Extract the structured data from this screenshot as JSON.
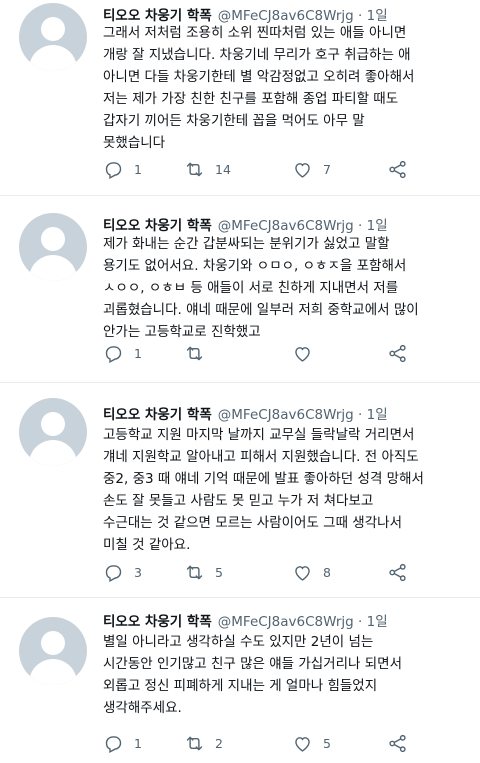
{
  "tweets": [
    {
      "name": "티오오 차웅기 학폭",
      "handle": "@MFeCJ8av6C8Wrjg",
      "time": "· 1일",
      "lines": [
        "그래서 저처럼 조용히 소위 찐따처럼 있는 애들 아니면",
        "개랑 잘 지냈습니다. 차웅기네 무리가 호구 취급하는 애",
        "아니면 다들 차웅기한테 별 악감정없고 오히려 좋아해서",
        "저는 제가 가장 친한 친구를 포함해 종업 파티할 때도",
        "갑자기 끼어든 차웅기한테 꼽을 먹어도 아무 말",
        "못했습니다"
      ],
      "replies": "1",
      "retweets": "14",
      "likes": "7"
    },
    {
      "name": "티오오 차웅기 학폭",
      "handle": "@MFeCJ8av6C8Wrjg",
      "time": "· 1일",
      "lines": [
        "제가 화내는 순간 갑분싸되는 분위기가 싫었고 말할",
        "용기도 없어서요. 차웅기와 ㅇㅁㅇ, ㅇㅎㅈ을 포함해서",
        "ㅅㅇㅇ, ㅇㅎㅂ 등 애들이 서로 친하게 지내면서 저를",
        "괴롭혔습니다. 얘네 때문에 일부러 저희 중학교에서 많이",
        "안가는 고등학교로 진학했고"
      ],
      "replies": "1",
      "retweets": "",
      "likes": ""
    },
    {
      "name": "티오오 차웅기 학폭",
      "handle": "@MFeCJ8av6C8Wrjg",
      "time": "· 1일",
      "lines": [
        "고등학교 지원 마지막 날까지 교무실 들락날락 거리면서",
        "걔네 지원학교 알아내고 피해서 지원했습니다. 전 아직도",
        "중2, 중3 때 얘네 기억 때문에 발표 좋아하던 성격 망해서",
        "손도 잘 못들고 사람도 못 믿고 누가 저 쳐다보고",
        "수근대는 것 같으면 모르는 사람이어도 그때 생각나서",
        "미칠 것 같아요."
      ],
      "replies": "3",
      "retweets": "5",
      "likes": "8"
    },
    {
      "name": "티오오 차웅기 학폭",
      "handle": "@MFeCJ8av6C8Wrjg",
      "time": "· 1일",
      "lines": [
        "별일 아니라고 생각하실 수도 있지만 2년이 넘는",
        "시간동안 인기많고 친구 많은 얘들 가십거리나 되면서",
        "외롭고 정신 피폐하게 지내는 게 얼마나 힘들었지",
        "생각해주세요."
      ],
      "replies": "1",
      "retweets": "2",
      "likes": "5"
    }
  ],
  "colors": {
    "text": "#0f1419",
    "muted": "#536471",
    "separator": "#e6ecf0"
  }
}
